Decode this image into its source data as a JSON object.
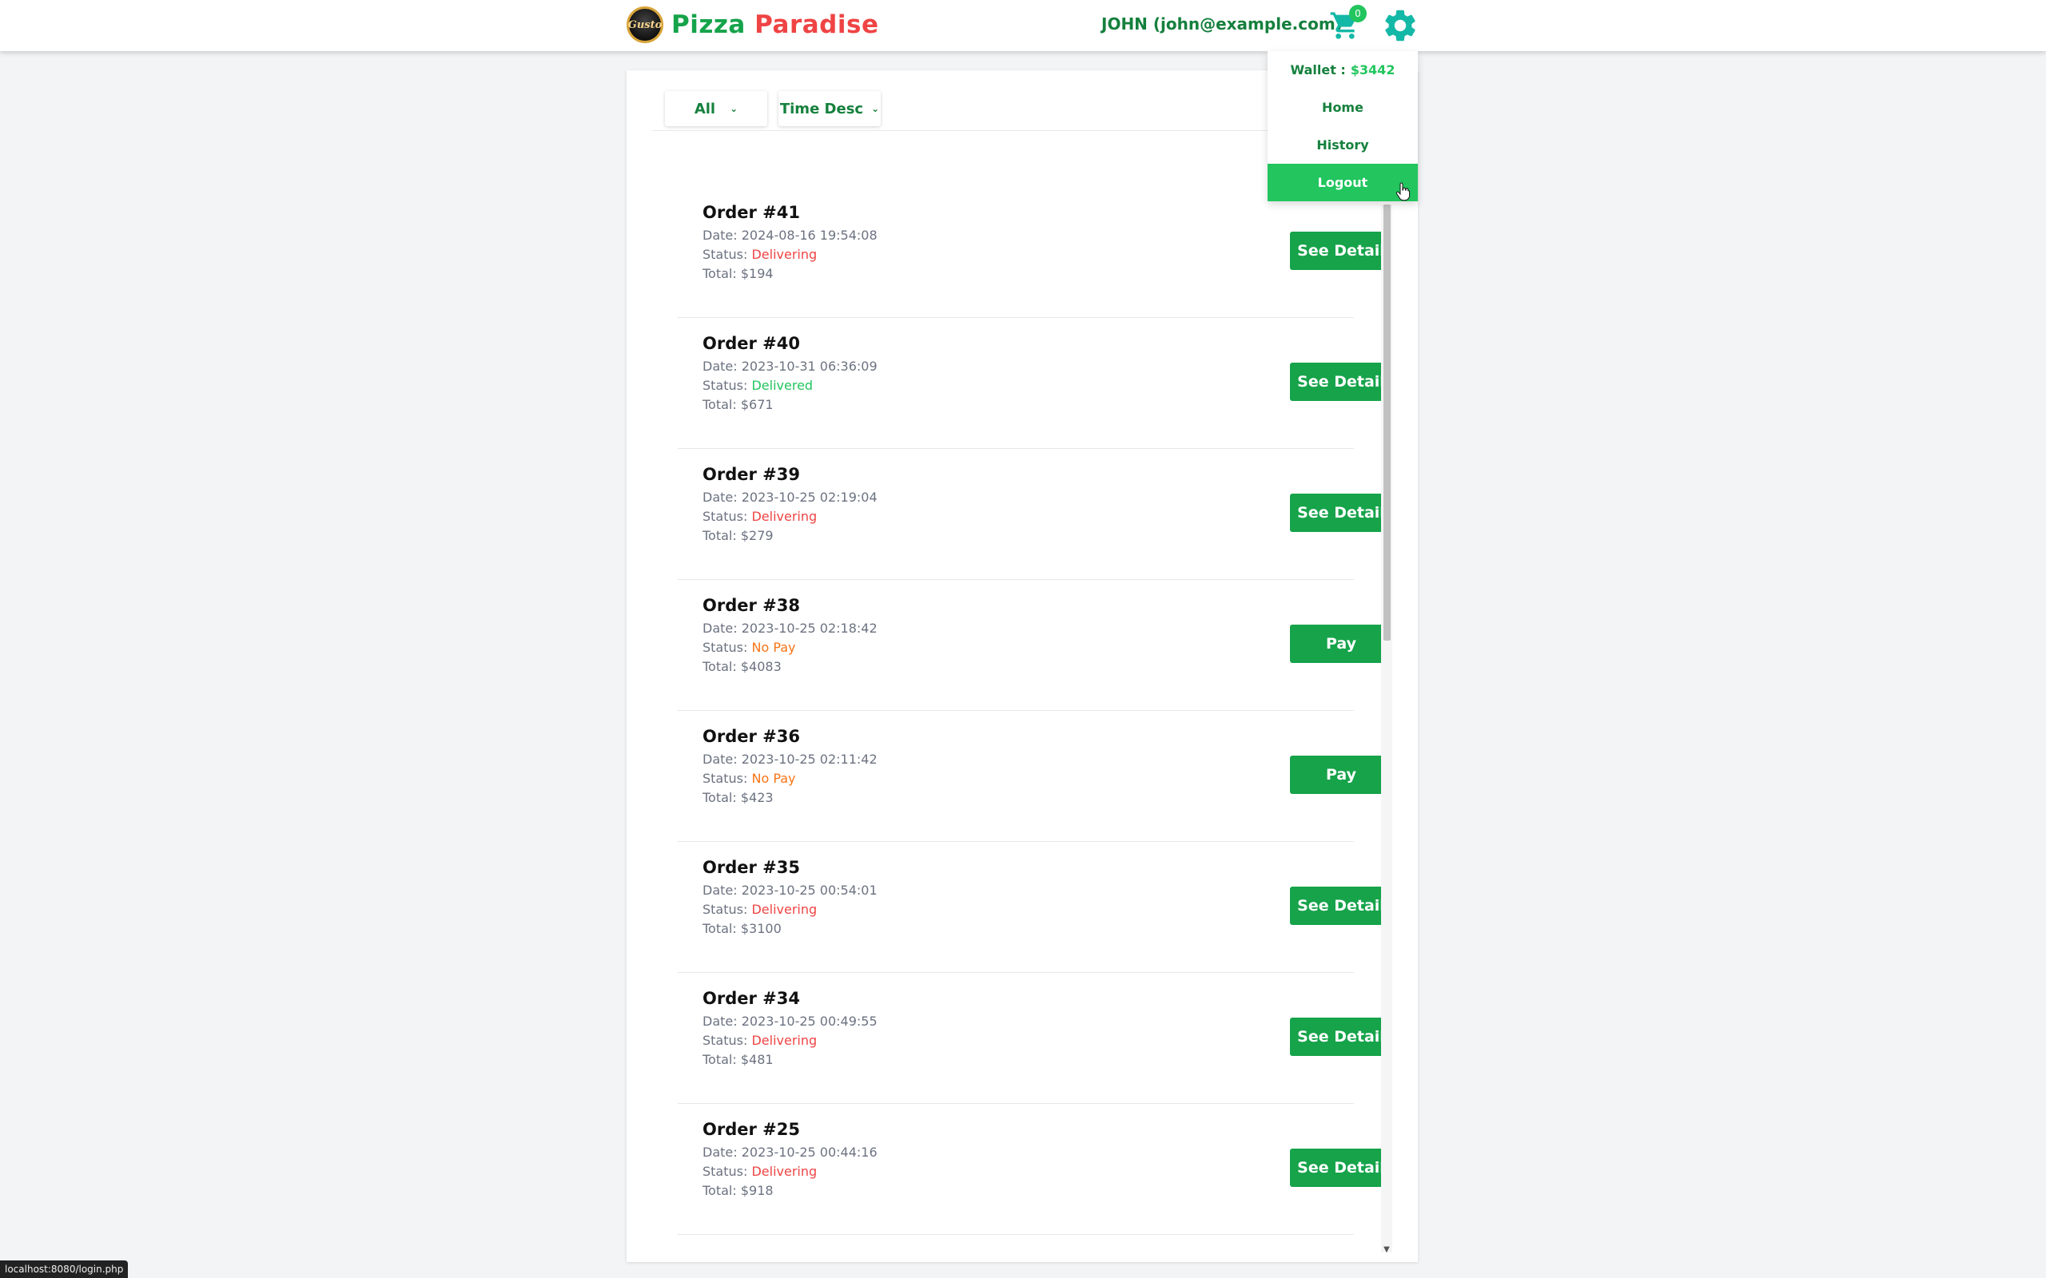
{
  "header": {
    "brand_part1": "Pizza",
    "brand_part2": "Paradise",
    "logo_text": "Gusto",
    "user_label": "JOHN (john@example.com)",
    "cart_count": "0"
  },
  "menu": {
    "wallet_label": "Wallet :",
    "wallet_amount": "$3442",
    "home": "Home",
    "history": "History",
    "logout": "Logout"
  },
  "filters": {
    "status_selected": "All",
    "sort_selected": "Time Desc"
  },
  "orders": [
    {
      "title": "Order #41",
      "date": "Date: 2024-08-16 19:54:08",
      "status_label": "Status: ",
      "status": "Delivering",
      "total": "Total: $194",
      "button": "See Detail"
    },
    {
      "title": "Order #40",
      "date": "Date: 2023-10-31 06:36:09",
      "status_label": "Status: ",
      "status": "Delivered",
      "total": "Total: $671",
      "button": "See Detail"
    },
    {
      "title": "Order #39",
      "date": "Date: 2023-10-25 02:19:04",
      "status_label": "Status: ",
      "status": "Delivering",
      "total": "Total: $279",
      "button": "See Detail"
    },
    {
      "title": "Order #38",
      "date": "Date: 2023-10-25 02:18:42",
      "status_label": "Status: ",
      "status": "No Pay",
      "total": "Total: $4083",
      "button": "Pay"
    },
    {
      "title": "Order #36",
      "date": "Date: 2023-10-25 02:11:42",
      "status_label": "Status: ",
      "status": "No Pay",
      "total": "Total: $423",
      "button": "Pay"
    },
    {
      "title": "Order #35",
      "date": "Date: 2023-10-25 00:54:01",
      "status_label": "Status: ",
      "status": "Delivering",
      "total": "Total: $3100",
      "button": "See Detail"
    },
    {
      "title": "Order #34",
      "date": "Date: 2023-10-25 00:49:55",
      "status_label": "Status: ",
      "status": "Delivering",
      "total": "Total: $481",
      "button": "See Detail"
    },
    {
      "title": "Order #25",
      "date": "Date: 2023-10-25 00:44:16",
      "status_label": "Status: ",
      "status": "Delivering",
      "total": "Total: $918",
      "button": "See Detail"
    }
  ],
  "statusbar": {
    "url": "localhost:8080/login.php"
  },
  "colors": {
    "primary_green": "#16a34a",
    "accent_green": "#22c55e",
    "brand_red": "#ef4444",
    "no_pay_orange": "#f97316"
  }
}
